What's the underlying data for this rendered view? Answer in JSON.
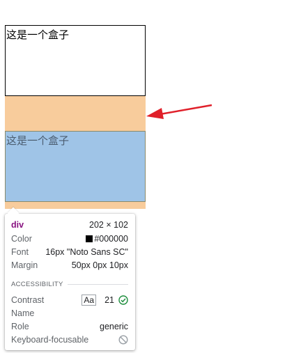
{
  "boxes": {
    "box1_text": "这是一个盒子",
    "box2_text": "这是一个盒子"
  },
  "colors": {
    "margin_highlight": "#f8cc9c",
    "content_highlight": "#9fc4e7",
    "arrow": "#e0202a",
    "tag": "#881280",
    "pass": "#1e8e3e"
  },
  "inspector": {
    "tag": "div",
    "size": "202 × 102",
    "color_label": "Color",
    "color_value": "#000000",
    "font_label": "Font",
    "font_value": "16px \"Noto Sans SC\"",
    "margin_label": "Margin",
    "margin_value": "50px 0px 10px",
    "accessibility_heading": "ACCESSIBILITY",
    "contrast_label": "Contrast",
    "contrast_aa": "Aa",
    "contrast_value": "21",
    "name_label": "Name",
    "role_label": "Role",
    "role_value": "generic",
    "focusable_label": "Keyboard-focusable",
    "icons": [
      "check-circle-icon",
      "not-allowed-icon"
    ]
  }
}
